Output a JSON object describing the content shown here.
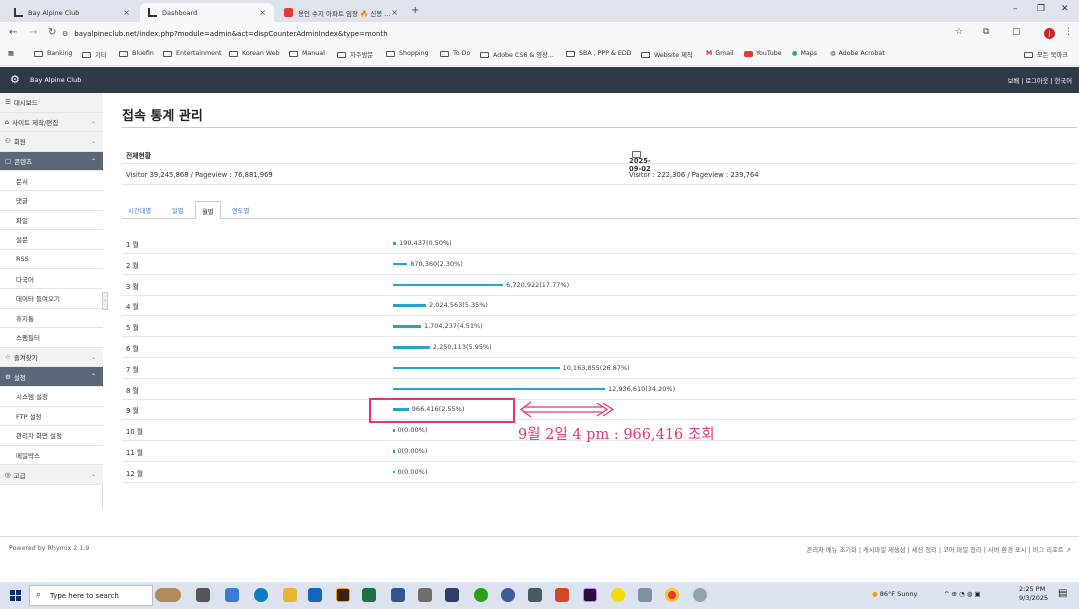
{
  "browser": {
    "tabs": [
      {
        "title": "Bay Alpine Club"
      },
      {
        "title": "Dashboard"
      },
      {
        "title": "용인 수지 아파트 임장 🔥 신봉 ..."
      }
    ],
    "new_tab": "+",
    "url": "bayalpineclub.net/index.php?module=admin&act=dispCounterAdminIndex&type=month",
    "bookmarks": [
      "Banking",
      "기타",
      "Bluefin",
      "Entertainment",
      "Korean Web",
      "Manual",
      "자주방문",
      "Shopping",
      "To Do",
      "Adobe CS6 & 영상...",
      "SBA , PPP & EDD",
      "Website 제작",
      "Gmail",
      "YouTube",
      "Maps",
      "Adobe Acrobat"
    ],
    "all_bookmarks": "모든 북마크",
    "profile_initial": "J"
  },
  "app": {
    "site_name": "Bay Alpine Club",
    "header_links": "보배 | 로그아웃 | 한국어"
  },
  "sidebar": {
    "items": [
      {
        "label": "대시보드",
        "kind": "group",
        "icon": "list-icon"
      },
      {
        "label": "사이트 제작/편집",
        "kind": "group",
        "icon": "home-icon",
        "caret": "⌄"
      },
      {
        "label": "회원",
        "kind": "group",
        "icon": "users-icon",
        "caret": "⌄"
      },
      {
        "label": "콘텐츠",
        "kind": "active",
        "icon": "content-icon",
        "caret": "⌃"
      },
      {
        "label": "문서",
        "kind": "sub"
      },
      {
        "label": "댓글",
        "kind": "sub"
      },
      {
        "label": "파일",
        "kind": "sub"
      },
      {
        "label": "설문",
        "kind": "sub"
      },
      {
        "label": "RSS",
        "kind": "sub"
      },
      {
        "label": "다국어",
        "kind": "sub"
      },
      {
        "label": "데이터 들여오기",
        "kind": "sub"
      },
      {
        "label": "휴지통",
        "kind": "sub"
      },
      {
        "label": "스팸필터",
        "kind": "sub"
      },
      {
        "label": "즐겨찾기",
        "kind": "group",
        "icon": "star-icon",
        "caret": "⌄"
      },
      {
        "label": "설정",
        "kind": "active",
        "icon": "gear-icon",
        "caret": "⌃"
      },
      {
        "label": "시스템 설정",
        "kind": "sub"
      },
      {
        "label": "FTP 설정",
        "kind": "sub"
      },
      {
        "label": "관리자 화면 설정",
        "kind": "sub"
      },
      {
        "label": "메일박스",
        "kind": "sub"
      },
      {
        "label": "고급",
        "kind": "group",
        "icon": "advanced-icon",
        "caret": "⌄"
      }
    ]
  },
  "main": {
    "title": "접속 통계 관리",
    "summary": {
      "total_label": "전체현황",
      "date_label": "2025-09-02",
      "total_values": "Visitor 39,245,868  /  Pageview : 76,881,969",
      "date_values": "Visitor : 222,306  /  Pageview : 239,764"
    },
    "tabs": [
      "시간대별",
      "일별",
      "월별",
      "연도별"
    ],
    "active_tab": 2,
    "months": [
      {
        "label": "1 월",
        "text": "190,437(0.50%)",
        "pct": 0.5
      },
      {
        "label": "2 월",
        "text": "870,360(2.30%)",
        "pct": 2.3
      },
      {
        "label": "3 월",
        "text": "6,720,922(17.77%)",
        "pct": 17.77
      },
      {
        "label": "4 월",
        "text": "2,024,563(5.35%)",
        "pct": 5.35
      },
      {
        "label": "5 월",
        "text": "1,704,237(4.51%)",
        "pct": 4.51
      },
      {
        "label": "6 월",
        "text": "2,250,113(5.95%)",
        "pct": 5.95
      },
      {
        "label": "7 월",
        "text": "10,163,855(26.87%)",
        "pct": 26.87
      },
      {
        "label": "8 월",
        "text": "12,936,610(34.20%)",
        "pct": 34.2
      },
      {
        "label": "9 월",
        "text": "966,416(2.55%)",
        "pct": 2.55
      },
      {
        "label": "10 월",
        "text": "0(0.00%)",
        "pct": 0
      },
      {
        "label": "11 월",
        "text": "0(0.00%)",
        "pct": 0
      },
      {
        "label": "12 월",
        "text": "0(0.00%)",
        "pct": 0
      }
    ],
    "bar_color": "#27a3c7"
  },
  "annotation": {
    "text": "9월 2일 4 pm : 966,416  조회",
    "color": "#e6337a"
  },
  "footer": {
    "powered": "Powered by Rhymix 2.1.9",
    "links": "관리자 메뉴 초기화 | 캐시파일 재생성 | 세션 정리 | 코어 파일 정리 | 서버 환경 표시 | 버그 리포트"
  },
  "taskbar": {
    "search_placeholder": "Type here to search",
    "weather": "86°F  Sunny",
    "time": "2:25 PM",
    "date": "9/3/2025"
  }
}
